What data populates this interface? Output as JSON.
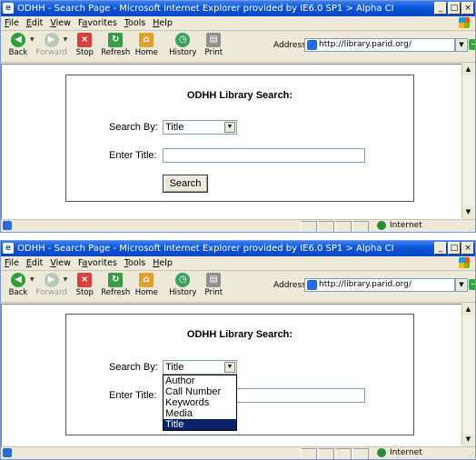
{
  "windows": [
    {
      "title": "ODHH - Search Page - Microsoft Internet Explorer provided by IE6.0 SP1 > Alpha CI",
      "menu": [
        "File",
        "Edit",
        "View",
        "Favorites",
        "Tools",
        "Help"
      ],
      "menu_accel": [
        "F",
        "E",
        "V",
        "a",
        "T",
        "H"
      ],
      "toolbar": [
        "Back",
        "Forward",
        "Stop",
        "Refresh",
        "Home",
        "History",
        "Print"
      ],
      "address_label": "Address",
      "address_url": "http://library.parid.org/",
      "go_label": "Go",
      "search_heading": "ODHH Library Search:",
      "search_by_label": "Search By:",
      "search_by_value": "Title",
      "enter_label": "Enter Title:",
      "enter_value": "",
      "search_button": "Search",
      "status_zone": "Internet"
    },
    {
      "title": "ODHH - Search Page - Microsoft Internet Explorer provided by IE6.0 SP1 > Alpha CI",
      "menu": [
        "File",
        "Edit",
        "View",
        "Favorites",
        "Tools",
        "Help"
      ],
      "menu_accel": [
        "F",
        "E",
        "V",
        "a",
        "T",
        "H"
      ],
      "toolbar": [
        "Back",
        "Forward",
        "Stop",
        "Refresh",
        "Home",
        "History",
        "Print"
      ],
      "address_label": "Address",
      "address_url": "http://library.parid.org/",
      "go_label": "Go",
      "search_heading": "ODHH Library Search:",
      "search_by_label": "Search By:",
      "search_by_value": "Title",
      "enter_label": "Enter Title:",
      "dropdown_options": [
        "Author",
        "Call Number",
        "Keywords",
        "Media",
        "Title"
      ],
      "dropdown_selected": "Title",
      "status_zone": "Internet"
    }
  ],
  "colors": {
    "titlebar": "#0a55d8",
    "selection": "#0a246a",
    "chrome": "#ece9d8"
  }
}
